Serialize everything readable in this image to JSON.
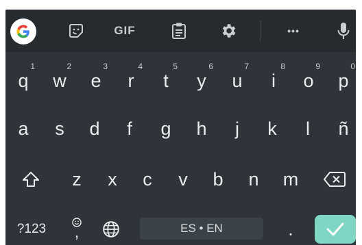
{
  "toolbar": {
    "items": [
      {
        "name": "google-logo-button",
        "icon": "google-g-icon"
      },
      {
        "name": "sticker-button",
        "icon": "sticker-icon"
      },
      {
        "name": "gif-button",
        "label": "GIF"
      },
      {
        "name": "clipboard-button",
        "icon": "clipboard-icon"
      },
      {
        "name": "settings-button",
        "icon": "gear-icon"
      },
      {
        "name": "more-button",
        "label": "•••"
      },
      {
        "name": "voice-input-button",
        "icon": "microphone-icon"
      }
    ]
  },
  "rows": [
    [
      "q",
      "w",
      "e",
      "r",
      "t",
      "y",
      "u",
      "i",
      "o",
      "p"
    ],
    [
      "a",
      "s",
      "d",
      "f",
      "g",
      "h",
      "j",
      "k",
      "l",
      "ñ"
    ],
    [
      "z",
      "x",
      "c",
      "v",
      "b",
      "n",
      "m"
    ]
  ],
  "hints": [
    "1",
    "2",
    "3",
    "4",
    "5",
    "6",
    "7",
    "8",
    "9",
    "0"
  ],
  "bottom": {
    "symbols_label": "?123",
    "comma_label": ",",
    "space_label": "ES • EN",
    "period_label": "."
  },
  "colors": {
    "background": "#2e3439",
    "toolbar": "#262b2f",
    "key_text": "#e9ecee",
    "enter": "#7fd6c5",
    "space": "#3c4348"
  }
}
